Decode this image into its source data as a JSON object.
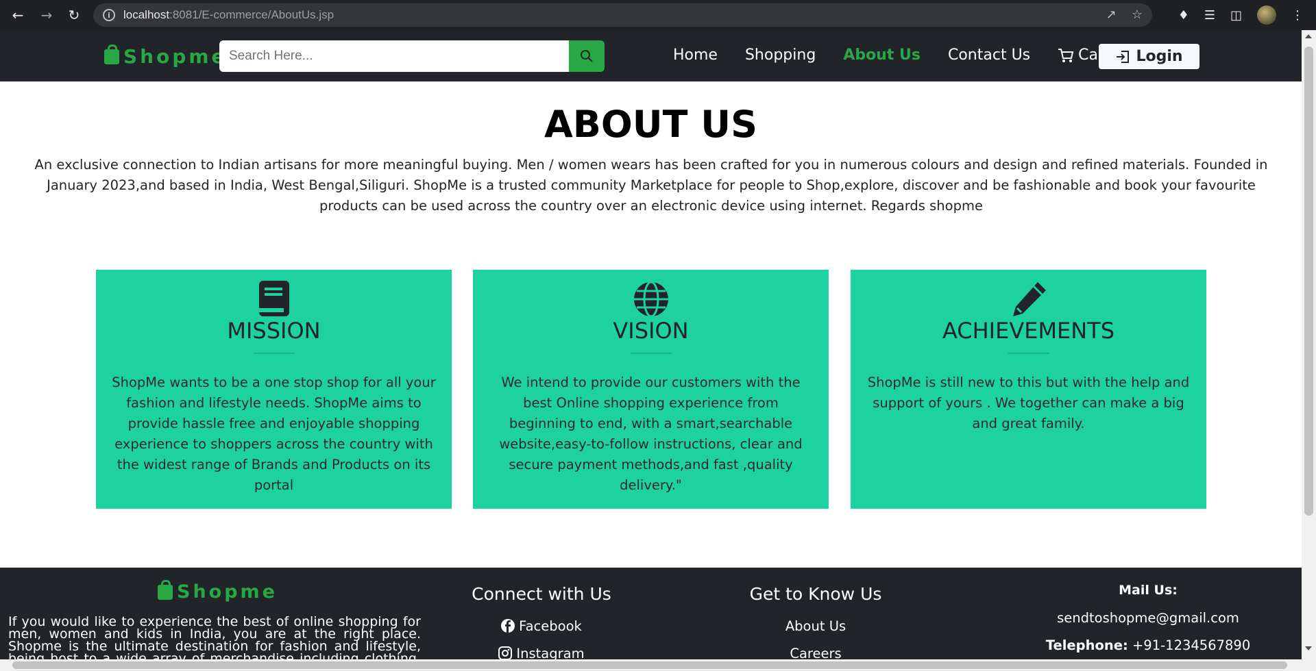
{
  "browser": {
    "url_host": "localhost",
    "url_rest": ":8081/E-commerce/AboutUs.jsp"
  },
  "navbar": {
    "brand": "Shopme",
    "search_placeholder": "Search Here...",
    "links": [
      {
        "label": "Home",
        "active": false
      },
      {
        "label": "Shopping",
        "active": false
      },
      {
        "label": "About Us",
        "active": true
      },
      {
        "label": "Contact Us",
        "active": false
      }
    ],
    "cart_label": "Cart",
    "login_label": "Login"
  },
  "about": {
    "title": "ABOUT US",
    "text": "An exclusive connection to Indian artisans for more meaningful buying. Men / women wears has been crafted for you in numerous colours and design and refined materials. Founded in January 2023,and based in India, West Bengal,Siliguri. ShopMe is a trusted community Marketplace for people to Shop,explore, discover and be fashionable and book your favourite products can be used across the country over an electronic device using internet. Regards shopme"
  },
  "cards": [
    {
      "icon": "book-icon",
      "title": "MISSION",
      "text": "ShopMe wants to be a one stop shop for all your fashion and lifestyle needs. ShopMe aims to provide hassle free and enjoyable shopping experience to shoppers across the country with the widest range of Brands and Products on its portal"
    },
    {
      "icon": "globe-icon",
      "title": "VISION",
      "text": "We intend to provide our customers with the best Online shopping experience from beginning to end, with a smart,searchable website,easy-to-follow instructions, clear and secure payment methods,and fast ,quality delivery.\""
    },
    {
      "icon": "pencil-icon",
      "title": "ACHIEVEMENTS",
      "text": "ShopMe is still new to this but with the help and support of yours . We together can make a big and great family."
    }
  ],
  "footer": {
    "brand": "Shopme",
    "about": "If you would like to experience the best of online shopping for men, women and kids in India, you are at the right place. Shopme is the ultimate destination for fashion and lifestyle, being host to a wide array of merchandise including clothing, footwear and more. Our",
    "connect": {
      "title": "Connect with Us",
      "items": [
        "Facebook",
        "Instagram"
      ]
    },
    "know": {
      "title": "Get to Know Us",
      "items": [
        "About Us",
        "Careers"
      ]
    },
    "mail": {
      "heading": "Mail Us:",
      "email": "sendtoshopme@gmail.com",
      "tel_label": "Telephone:",
      "tel_value": "+91-1234567890"
    }
  },
  "colors": {
    "accent_green": "#28a745",
    "card_bg": "#1dd1a1",
    "navbar_bg": "#212529"
  }
}
